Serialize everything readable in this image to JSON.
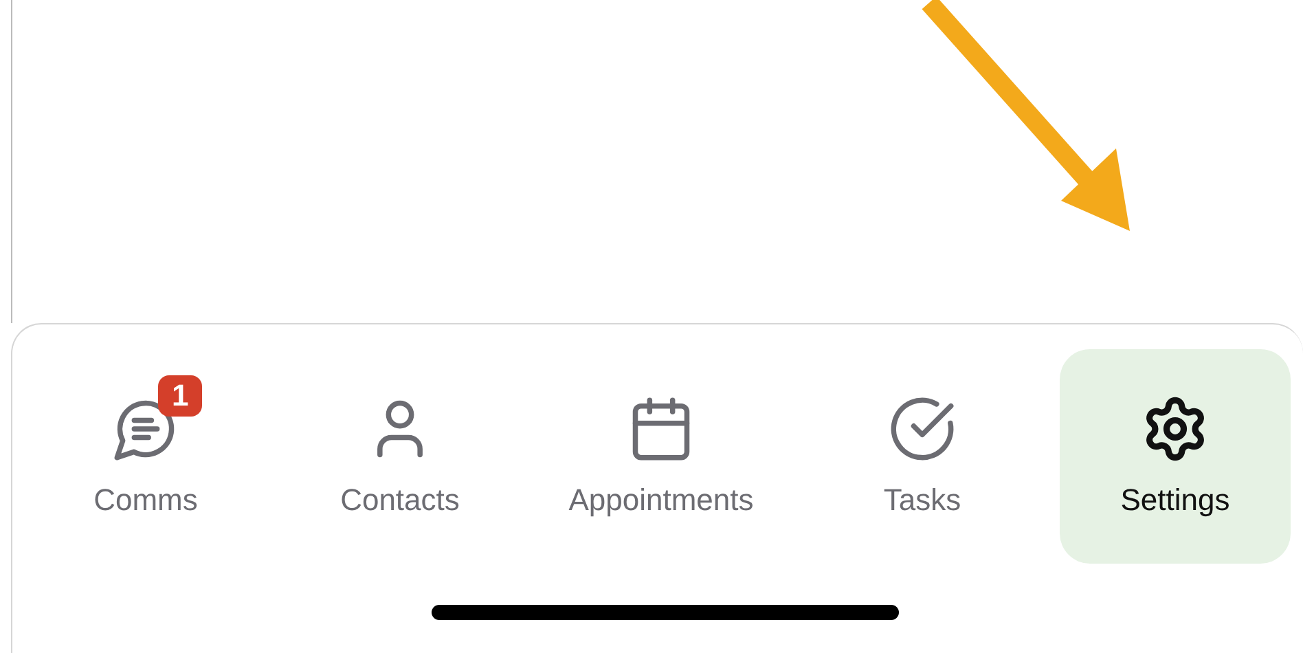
{
  "tab_bar": {
    "tabs": [
      {
        "label": "Comms",
        "kind": "chat",
        "selected": false,
        "badge": "1"
      },
      {
        "label": "Contacts",
        "kind": "person",
        "selected": false
      },
      {
        "label": "Appointments",
        "kind": "calendar",
        "selected": false
      },
      {
        "label": "Tasks",
        "kind": "check",
        "selected": false
      },
      {
        "label": "Settings",
        "kind": "gear",
        "selected": true
      }
    ]
  }
}
